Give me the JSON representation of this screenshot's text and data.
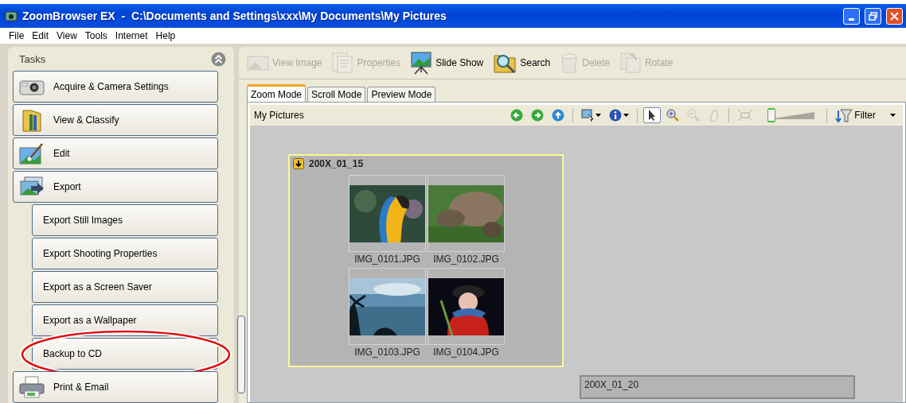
{
  "window": {
    "title": "ZoomBrowser EX  -  C:\\Documents and Settings\\xxx\\My Documents\\My Pictures"
  },
  "menu": [
    "File",
    "Edit",
    "View",
    "Tools",
    "Internet",
    "Help"
  ],
  "tasks": {
    "title": "Tasks",
    "items": [
      {
        "kind": "main",
        "label": "Acquire & Camera Settings",
        "annotated": false
      },
      {
        "kind": "main",
        "label": "View & Classify",
        "annotated": false
      },
      {
        "kind": "main",
        "label": "Edit",
        "annotated": false
      },
      {
        "kind": "main",
        "label": "Export",
        "annotated": false
      },
      {
        "kind": "sub",
        "label": "Export Still Images",
        "annotated": false
      },
      {
        "kind": "sub",
        "label": "Export Shooting Properties",
        "annotated": false
      },
      {
        "kind": "sub",
        "label": "Export as a Screen Saver",
        "annotated": false
      },
      {
        "kind": "sub",
        "label": "Export as a Wallpaper",
        "annotated": false
      },
      {
        "kind": "sub",
        "label": "Backup to CD",
        "annotated": true
      },
      {
        "kind": "main",
        "label": "Print & Email",
        "annotated": false
      }
    ]
  },
  "toolbar": [
    {
      "label": "View Image",
      "disabled": true
    },
    {
      "label": "Properties",
      "disabled": true
    },
    {
      "label": "Slide Show",
      "disabled": false
    },
    {
      "label": "Search",
      "disabled": false
    },
    {
      "label": "Delete",
      "disabled": true
    },
    {
      "label": "Rotate",
      "disabled": true
    }
  ],
  "tabs": [
    {
      "label": "Zoom Mode",
      "selected": true
    },
    {
      "label": "Scroll Mode",
      "selected": false
    },
    {
      "label": "Preview Mode",
      "selected": false
    }
  ],
  "location": "My Pictures",
  "zoom": {
    "level": 0.05
  },
  "filter": {
    "label": "Filter"
  },
  "groups": [
    {
      "title": "200X_01_15",
      "selected": true,
      "images": [
        {
          "name": "IMG_0101.JPG",
          "kind": "picture"
        },
        {
          "name": "IMG_0102.JPG",
          "kind": "picture"
        },
        {
          "name": "IMG_0103.JPG",
          "kind": "picture"
        },
        {
          "name": "IMG_0104.JPG",
          "kind": "picture"
        }
      ]
    },
    {
      "title": "200X_01_20",
      "selected": false
    }
  ]
}
